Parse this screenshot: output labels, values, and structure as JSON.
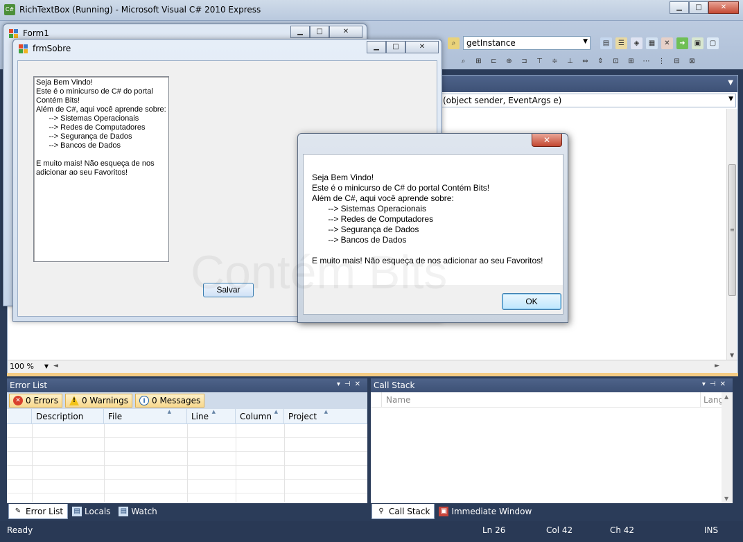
{
  "vs_window": {
    "title": "RichTextBox (Running) - Microsoft Visual C# 2010 Express",
    "app_icon_label": "C#",
    "buttons": {
      "minimize": "▁",
      "maximize": "□",
      "close": "✕"
    }
  },
  "toolbar": {
    "find_combo_value": "getInstance"
  },
  "editor": {
    "member_combo_value": "(object sender, EventArgs e)",
    "zoom": "100 %"
  },
  "error_list": {
    "title": "Error List",
    "errors_label": "0 Errors",
    "warnings_label": "0 Warnings",
    "messages_label": "0 Messages",
    "columns": [
      "",
      "Description",
      "File",
      "Line",
      "Column",
      "Project"
    ]
  },
  "call_stack": {
    "title": "Call Stack",
    "columns": [
      "Name",
      "Lang"
    ]
  },
  "bottom_tabs_left": [
    "Error List",
    "Locals",
    "Watch"
  ],
  "bottom_tabs_right": [
    "Call Stack",
    "Immediate Window"
  ],
  "status_bar": {
    "state": "Ready",
    "ln": "Ln 26",
    "col": "Col 42",
    "ch": "Ch 42",
    "mode": "INS"
  },
  "form1": {
    "title": "Form1"
  },
  "frmsobre": {
    "title": "frmSobre",
    "richtext": "Seja Bem Vindo!\nEste é o minicurso de C# do portal\nContém Bits!\nAlém de C#, aqui você aprende sobre:\n      --> Sistemas Operacionais\n      --> Redes de Computadores\n      --> Segurança de Dados\n      --> Bancos de Dados\n\nE muito mais! Não esqueça de nos\nadicionar ao seu Favoritos!",
    "save_label": "Salvar"
  },
  "msgbox": {
    "message": "Seja Bem Vindo!\nEste é o minicurso de C# do portal Contém Bits!\nAlém de C#, aqui você aprende sobre:\n       --> Sistemas Operacionais\n       --> Redes de Computadores\n       --> Segurança de Dados\n       --> Bancos de Dados\n\nE muito mais! Não esqueça de nos adicionar ao seu Favoritos!",
    "ok_label": "OK",
    "close_label": "✕",
    "watermark": "Contém Bits"
  }
}
